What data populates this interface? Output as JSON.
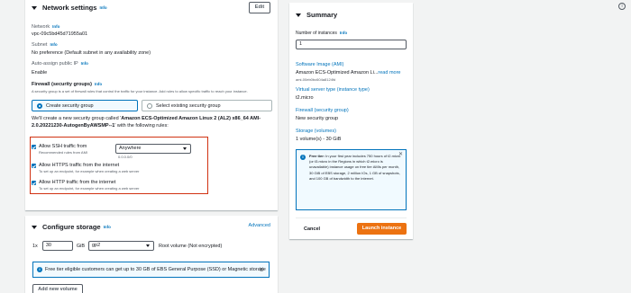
{
  "network": {
    "title": "Network settings",
    "info": "Info",
    "edit": "Edit",
    "network_label": "Network",
    "network_value": "vpc-09c5bd45d71955a01",
    "subnet_label": "Subnet",
    "subnet_value": "No preference (Default subnet in any availability zone)",
    "public_ip_label": "Auto-assign public IP",
    "public_ip_value": "Enable",
    "firewall_title": "Firewall (security groups)",
    "firewall_desc": "A security group is a set of firewall rules that control the traffic for your instance. Add rules to allow specific traffic to reach your instance.",
    "create_sg": "Create security group",
    "select_sg": "Select existing security group",
    "note_prefix": "We'll create a new security group called '",
    "sg_name": "Amazon ECS-Optimized Amazon Linux 2 (AL2) x86_64 AMI-2.0.20221230-AutogenByAWSMP--1",
    "note_suffix": "' with the following rules:",
    "ssh_label": "Allow SSH traffic from",
    "ssh_sub": "Recommended rules from AMI",
    "ssh_source": "Anywhere",
    "ssh_cidr": "0.0.0.0/0",
    "https_label": "Allow HTTPS traffic from the internet",
    "https_sub": "To set up an endpoint, for example when creating a web server",
    "http_label": "Allow HTTP traffic from the internet",
    "http_sub": "To set up an endpoint, for example when creating a web server"
  },
  "storage": {
    "title": "Configure storage",
    "info": "Info",
    "advanced": "Advanced",
    "prefix": "1x",
    "size": "30",
    "unit": "GiB",
    "type": "gp2",
    "root_label": "Root volume  (Not encrypted)",
    "free_tier": "Free tier eligible customers can get up to 30 GB of EBS General Purpose (SSD) or Magnetic storage",
    "add_volume": "Add new volume"
  },
  "summary": {
    "title": "Summary",
    "instances_label": "Number of instances",
    "instances_info": "Info",
    "instances_value": "1",
    "ami_label": "Software Image (AMI)",
    "ami_value": "Amazon ECS-Optimized Amazon Li...",
    "read_more": "read more",
    "ami_id": "ami-00eb0bc604a8124fd",
    "instance_type_label": "Virtual server type (instance type)",
    "instance_type_value": "t2.micro",
    "firewall_label": "Firewall (security group)",
    "firewall_value": "New security group",
    "storage_label": "Storage (volumes)",
    "storage_value": "1 volume(s) - 30 GiB",
    "free_tier_bold": "Free tier:",
    "free_tier_text": " In your first year includes 750 hours of t2.micro (or t3.micro in the Regions in which t2.micro is unavailable) instance usage on free tier AMIs per month, 30 GiB of EBS storage, 2 million IOs, 1 GB of snapshots, and 100 GB of bandwidth to the internet.",
    "cancel": "Cancel",
    "launch": "Launch instance"
  }
}
